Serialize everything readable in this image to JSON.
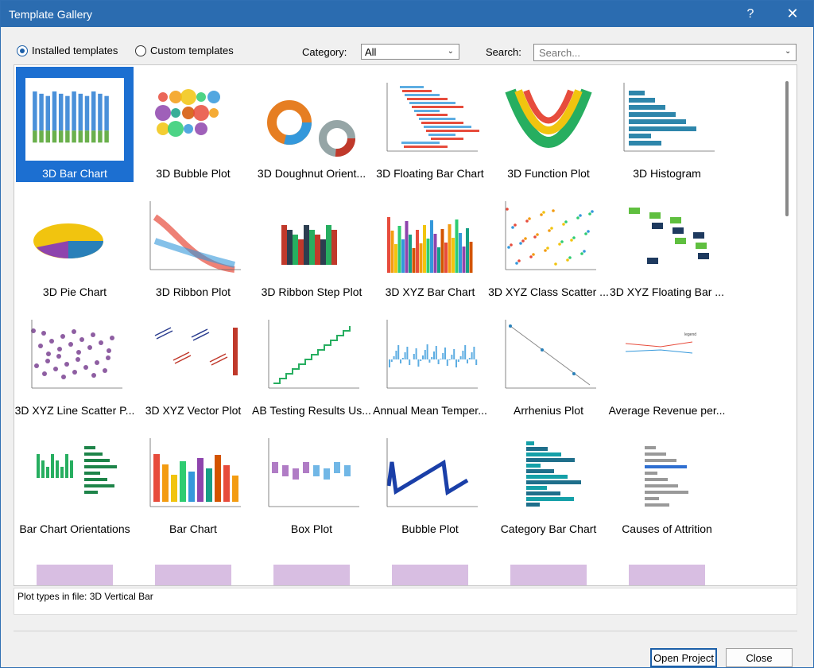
{
  "window": {
    "title": "Template Gallery",
    "help_label": "?",
    "close_label": "✕"
  },
  "toolbar": {
    "installed_label": "Installed templates",
    "custom_label": "Custom templates",
    "category_label": "Category:",
    "category_value": "All",
    "search_label": "Search:",
    "search_placeholder": "Search..."
  },
  "templates": [
    {
      "label": "3D Bar Chart",
      "icon": "bars3d"
    },
    {
      "label": "3D Bubble Plot",
      "icon": "bubbles"
    },
    {
      "label": "3D Doughnut Orient...",
      "icon": "donut"
    },
    {
      "label": "3D Floating Bar Chart",
      "icon": "floatbar"
    },
    {
      "label": "3D Function Plot",
      "icon": "function"
    },
    {
      "label": "3D Histogram",
      "icon": "histo"
    },
    {
      "label": "3D Pie Chart",
      "icon": "pie"
    },
    {
      "label": "3D Ribbon Plot",
      "icon": "ribbon"
    },
    {
      "label": "3D Ribbon Step Plot",
      "icon": "stepribbon"
    },
    {
      "label": "3D XYZ Bar Chart",
      "icon": "xyzbar"
    },
    {
      "label": "3D XYZ Class Scatter ...",
      "icon": "classscatter"
    },
    {
      "label": "3D XYZ Floating Bar ...",
      "icon": "xyzfloat"
    },
    {
      "label": "3D XYZ Line Scatter P...",
      "icon": "linescatter"
    },
    {
      "label": "3D XYZ Vector Plot",
      "icon": "vector"
    },
    {
      "label": "AB Testing Results Us...",
      "icon": "abtest"
    },
    {
      "label": "Annual Mean Temper...",
      "icon": "annual"
    },
    {
      "label": "Arrhenius Plot",
      "icon": "arrhenius"
    },
    {
      "label": "Average Revenue per...",
      "icon": "revenue"
    },
    {
      "label": "Bar Chart Orientations",
      "icon": "orient"
    },
    {
      "label": "Bar Chart",
      "icon": "bar"
    },
    {
      "label": "Box Plot",
      "icon": "box"
    },
    {
      "label": "Bubble Plot",
      "icon": "bubble2d"
    },
    {
      "label": "Category Bar Chart",
      "icon": "catbar"
    },
    {
      "label": "Causes of Attrition",
      "icon": "attrition"
    },
    {
      "label": "",
      "icon": "row5a"
    },
    {
      "label": "",
      "icon": "row5b"
    },
    {
      "label": "",
      "icon": "row5c"
    },
    {
      "label": "",
      "icon": "row5d"
    },
    {
      "label": "",
      "icon": "row5e"
    },
    {
      "label": "",
      "icon": "row5f"
    }
  ],
  "selected_index": 0,
  "info": {
    "text": "Plot types in file: 3D Vertical Bar"
  },
  "buttons": {
    "open_label": "Open Project",
    "close_label": "Close"
  }
}
